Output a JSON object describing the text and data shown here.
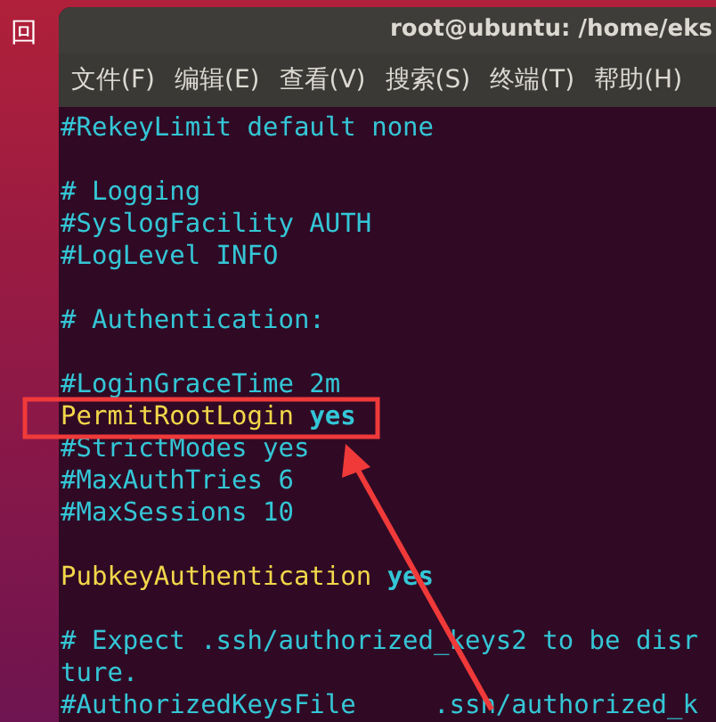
{
  "desktop": {
    "icon_label": "回"
  },
  "window": {
    "title": "root@ubuntu: /home/eks"
  },
  "menu": [
    "文件(F)",
    "编辑(E)",
    "查看(V)",
    "搜索(S)",
    "终端(T)",
    "帮助(H)"
  ],
  "lines": [
    {
      "kind": "comment",
      "text": "#RekeyLimit default none"
    },
    {
      "kind": "blank"
    },
    {
      "kind": "comment",
      "text": "# Logging"
    },
    {
      "kind": "comment",
      "text": "#SyslogFacility AUTH"
    },
    {
      "kind": "comment",
      "text": "#LogLevel INFO"
    },
    {
      "kind": "blank"
    },
    {
      "kind": "comment",
      "text": "# Authentication:"
    },
    {
      "kind": "blank"
    },
    {
      "kind": "comment",
      "text": "#LoginGraceTime 2m"
    },
    {
      "kind": "directive",
      "key": "PermitRootLogin",
      "value": "yes",
      "highlighted": true
    },
    {
      "kind": "comment",
      "text": "#StrictModes yes"
    },
    {
      "kind": "comment",
      "text": "#MaxAuthTries 6"
    },
    {
      "kind": "comment",
      "text": "#MaxSessions 10"
    },
    {
      "kind": "blank"
    },
    {
      "kind": "directive",
      "key": "PubkeyAuthentication",
      "value": "yes",
      "highlighted": false
    },
    {
      "kind": "blank"
    },
    {
      "kind": "comment",
      "text": "# Expect .ssh/authorized_keys2 to be disr"
    },
    {
      "kind": "comment",
      "text": "ture."
    },
    {
      "kind": "comment",
      "text": "#AuthorizedKeysFile     .ssh/authorized_k"
    }
  ]
}
